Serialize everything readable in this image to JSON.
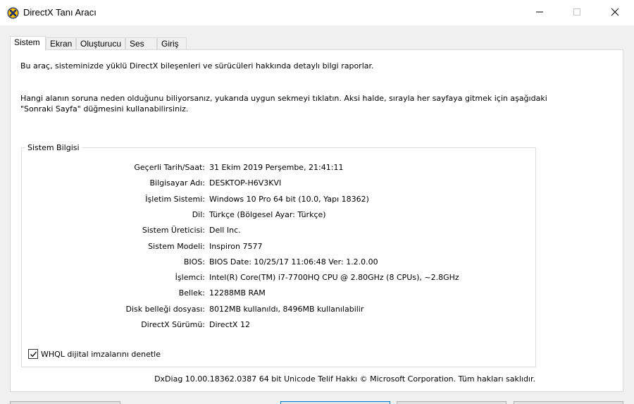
{
  "window": {
    "title": "DirectX Tanı Aracı",
    "icon": "directx-icon",
    "controls": [
      "minimize-icon",
      "maximize-icon",
      "close-icon"
    ]
  },
  "tabs": [
    {
      "label": "Sistem",
      "active": true
    },
    {
      "label": "Ekran",
      "active": false
    },
    {
      "label": "Oluşturucu",
      "active": false
    },
    {
      "label": "Ses",
      "active": false
    },
    {
      "label": "Giriş",
      "active": false
    }
  ],
  "panel": {
    "intro": "Bu araç, sisteminizde yüklü DirectX bileşenleri ve sürücüleri hakkında detaylı bilgi raporlar.",
    "hint_line1": "Hangi alanın soruna neden olduğunu biliyorsanız, yukarıda uygun sekmeyi tıklatın. Aksi halde, sırayla her sayfaya gitmek için aşağıdaki",
    "hint_line2": "\"Sonraki Sayfa\" düğmesini kullanabilirsiniz.",
    "group_label": "Sistem Bilgisi",
    "system_info": [
      {
        "label": "Geçerli Tarih/Saat:",
        "value": "31 Ekim 2019 Perşembe, 21:41:11"
      },
      {
        "label": "Bilgisayar Adı:",
        "value": "DESKTOP-H6V3KVI"
      },
      {
        "label": "İşletim Sistemi:",
        "value": "Windows 10 Pro 64 bit (10.0, Yapı 18362)"
      },
      {
        "label": "Dil:",
        "value": "Türkçe (Bölgesel Ayar: Türkçe)"
      },
      {
        "label": "Sistem Üreticisi:",
        "value": "Dell Inc."
      },
      {
        "label": "Sistem Modeli:",
        "value": "Inspiron 7577"
      },
      {
        "label": "BIOS:",
        "value": "BIOS Date: 10/25/17 11:06:48 Ver: 1.2.0.00"
      },
      {
        "label": "İşlemci:",
        "value": "Intel(R) Core(TM) i7-7700HQ CPU @ 2.80GHz (8 CPUs), ~2.8GHz"
      },
      {
        "label": "Bellek:",
        "value": "12288MB RAM"
      },
      {
        "label": "Disk belleği dosyası:",
        "value": "8012MB kullanıldı, 8496MB kullanılabilir"
      },
      {
        "label": "DirectX Sürümü:",
        "value": "DirectX 12"
      }
    ],
    "whql_checkbox": {
      "label": "WHQL dijital imzalarını denetle",
      "checked": true
    },
    "footer": "DxDiag 10.00.18362.0387 64 bit Unicode  Telif Hakkı © Microsoft Corporation. Tüm hakları saklıdır."
  },
  "colors": {
    "accent": "#0078d7",
    "window_bg": "#f0f0f0",
    "panel_bg": "#ffffff",
    "border": "#d9d9d9"
  }
}
